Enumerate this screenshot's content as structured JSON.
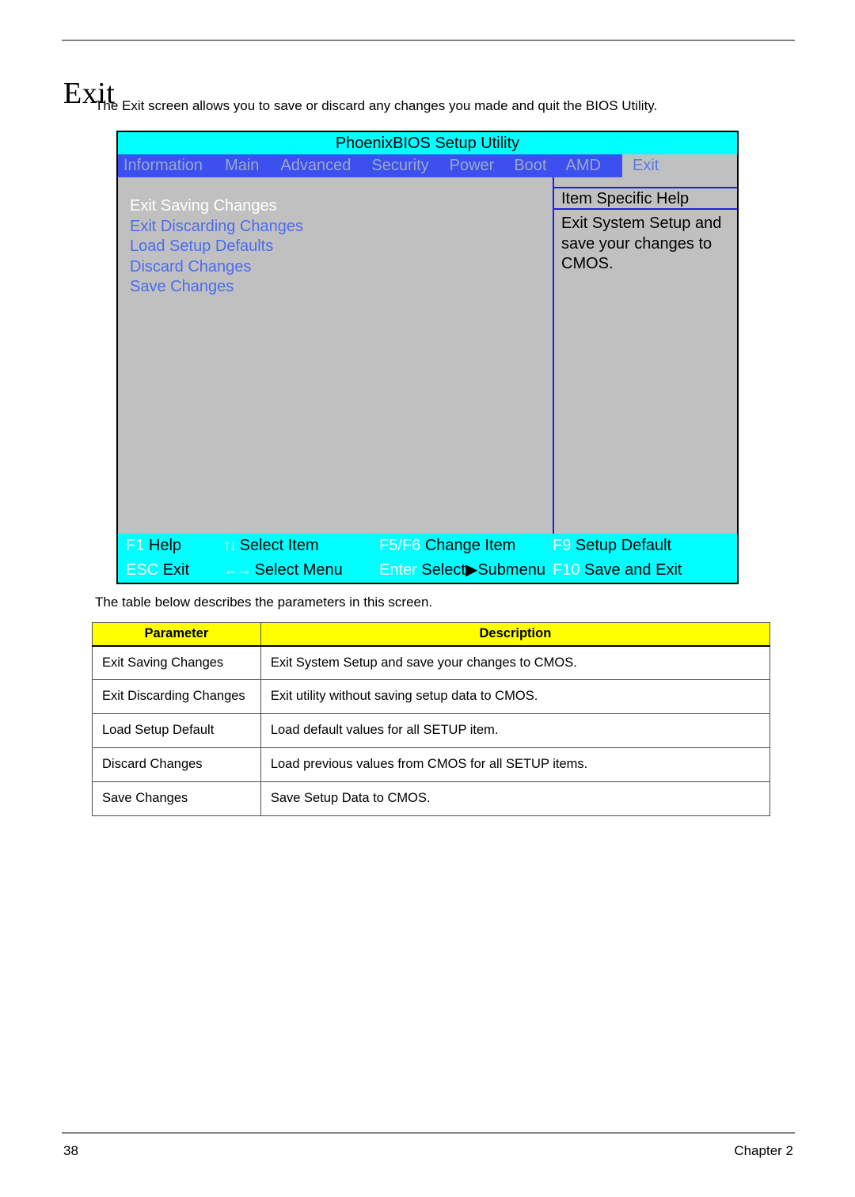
{
  "page": {
    "title": "Exit",
    "intro": "The Exit screen allows you to save or discard any changes you made and quit the BIOS Utility.",
    "table_intro": "The table below describes the parameters in this screen.",
    "page_number": "38",
    "chapter": "Chapter 2"
  },
  "bios": {
    "title": "PhoenixBIOS Setup Utility",
    "tabs": [
      {
        "label": "Information",
        "active": false
      },
      {
        "label": "Main",
        "active": false
      },
      {
        "label": "Advanced",
        "active": false
      },
      {
        "label": "Security",
        "active": false
      },
      {
        "label": "Power",
        "active": false
      },
      {
        "label": "Boot",
        "active": false
      },
      {
        "label": "AMD",
        "active": false
      },
      {
        "label": "Exit",
        "active": true
      }
    ],
    "options": [
      {
        "label": "Exit Saving Changes",
        "selected": true
      },
      {
        "label": "Exit Discarding Changes",
        "selected": false
      },
      {
        "label": "Load Setup Defaults",
        "selected": false
      },
      {
        "label": "Discard Changes",
        "selected": false
      },
      {
        "label": "Save Changes",
        "selected": false
      }
    ],
    "help": {
      "title": "Item Specific Help",
      "lines": [
        "Exit System Setup and",
        "save your changes to",
        "CMOS."
      ]
    },
    "keybar": {
      "row1": [
        {
          "key": "F1",
          "desc": "Help"
        },
        {
          "key": "↑↓",
          "desc": "Select Item"
        },
        {
          "key": "F5/F6",
          "desc": "Change Item"
        },
        {
          "key": "F9",
          "desc": "Setup Default"
        }
      ],
      "row2": [
        {
          "key": "ESC",
          "desc": "Exit"
        },
        {
          "key": "←→",
          "desc": "Select Menu"
        },
        {
          "key": "Enter",
          "desc": "Select▶Submenu"
        },
        {
          "key": "F10",
          "desc": "Save and Exit"
        }
      ]
    },
    "colors": {
      "title_bar": "#00ffff",
      "menu_bar": "#3c50f0",
      "body": "#c0c0c0",
      "selected_option": "#ffffff",
      "option": "#4a6cf0",
      "divider": "#2020e0"
    }
  },
  "param_table": {
    "headers": [
      "Parameter",
      "Description"
    ],
    "rows": [
      [
        "Exit Saving Changes",
        "Exit System Setup and save your changes to CMOS."
      ],
      [
        "Exit Discarding Changes",
        "Exit utility without saving setup data to CMOS."
      ],
      [
        "Load Setup Default",
        "Load default values for all SETUP item."
      ],
      [
        "Discard Changes",
        "Load previous values from CMOS for all SETUP items."
      ],
      [
        "Save Changes",
        "Save Setup Data to CMOS."
      ]
    ],
    "header_bg": "#ffff00"
  }
}
